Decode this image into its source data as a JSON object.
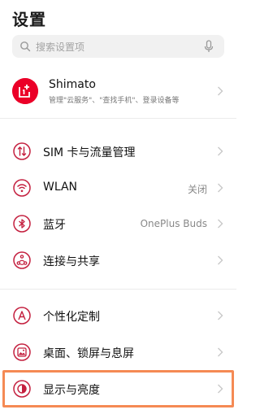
{
  "header": {
    "title": "设置"
  },
  "search": {
    "placeholder": "搜索设置项"
  },
  "account": {
    "name": "Shimato",
    "subtitle": "管理\"云服务\"、\"查找手机\"、登录设备等"
  },
  "rows": [
    {
      "label": "SIM 卡与流量管理",
      "value": ""
    },
    {
      "label": "WLAN",
      "value": "关闭"
    },
    {
      "label": "蓝牙",
      "value": "OnePlus Buds"
    },
    {
      "label": "连接与共享",
      "value": ""
    },
    {
      "label": "个性化定制",
      "value": ""
    },
    {
      "label": "桌面、锁屏与息屏",
      "value": ""
    },
    {
      "label": "显示与亮度",
      "value": ""
    }
  ],
  "colors": {
    "accent": "#c4203f",
    "brand": "#eb0028",
    "highlight": "#f58a54"
  },
  "icons": [
    "search-icon",
    "mic-icon",
    "oneplus-logo",
    "sim-icon",
    "wifi-icon",
    "bluetooth-icon",
    "share-icon",
    "personalize-icon",
    "wallpaper-icon",
    "display-icon",
    "chevron-right-icon"
  ]
}
